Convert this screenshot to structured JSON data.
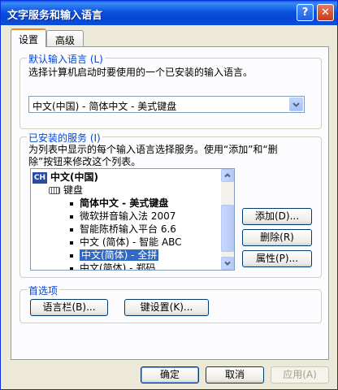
{
  "window": {
    "title": "文字服务和输入语言",
    "help_glyph": "?",
    "close_glyph": "✕"
  },
  "tabs": [
    {
      "label": "设置",
      "active": true
    },
    {
      "label": "高级",
      "active": false
    }
  ],
  "default_language": {
    "legend": "默认输入语言 (L)",
    "description": "选择计算机启动时要使用的一个已安装的输入语言。",
    "selected": "中文(中国) - 简体中文 - 美式键盘"
  },
  "installed_services": {
    "legend": "已安装的服务 (I)",
    "description_line1": "为列表中显示的每个输入语言选择服务。使用“添加”和“删",
    "description_line2": "除”按钮来修改这个列表。",
    "language_node": {
      "icon_text": "CH",
      "label": "中文(中国)"
    },
    "keyboard_node": {
      "label": "键盘"
    },
    "items": [
      {
        "label": "简体中文 - 美式键盘",
        "bold": true,
        "selected": false
      },
      {
        "label": "微软拼音输入法 2007",
        "bold": false,
        "selected": false
      },
      {
        "label": "智能陈桥输入平台 6.6",
        "bold": false,
        "selected": false
      },
      {
        "label": "中文 (简体) - 智能 ABC",
        "bold": false,
        "selected": false
      },
      {
        "label": "中文(简体) - 全拼",
        "bold": false,
        "selected": true
      },
      {
        "label": "中文(简体) - 郑码",
        "bold": false,
        "selected": false
      }
    ],
    "buttons": {
      "add": "添加(D)...",
      "remove": "删除(R)",
      "properties": "属性(P)..."
    }
  },
  "preferences": {
    "legend": "首选项",
    "language_bar": "语言栏(B)...",
    "key_settings": "键设置(K)..."
  },
  "footer": {
    "ok": "确定",
    "cancel": "取消",
    "apply": "应用(A)"
  }
}
